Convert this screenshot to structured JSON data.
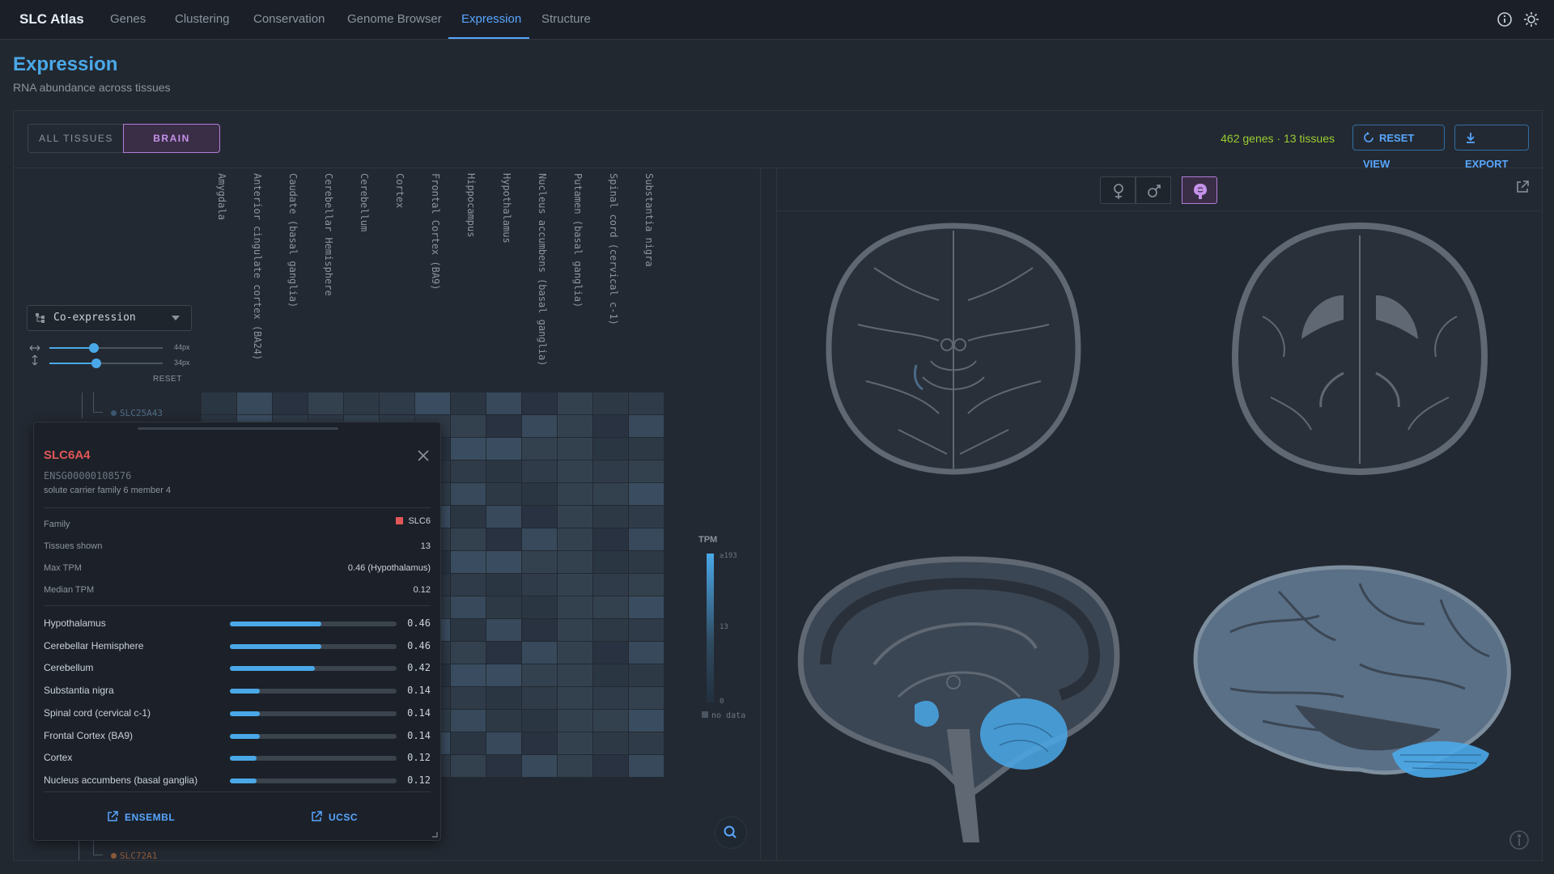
{
  "nav": {
    "brand": "SLC Atlas",
    "tabs": [
      "Genes",
      "Clustering",
      "Conservation",
      "Genome Browser",
      "Expression",
      "Structure"
    ],
    "active_tab": "Expression"
  },
  "header": {
    "title": "Expression",
    "subtitle": "RNA abundance across tissues"
  },
  "toolbar": {
    "segment_all": "ALL TISSUES",
    "segment_brain": "BRAIN",
    "active_segment": "BRAIN",
    "stats": "462 genes · 13 tissues",
    "reset_view": "RESET VIEW",
    "export": "EXPORT"
  },
  "heatmap": {
    "columns": [
      "Amygdala",
      "Anterior cingulate cortex (BA24)",
      "Caudate (basal ganglia)",
      "Cerebellar Hemisphere",
      "Cerebellum",
      "Cortex",
      "Frontal Cortex (BA9)",
      "Hippocampus",
      "Hypothalamus",
      "Nucleus accumbens (basal ganglia)",
      "Putamen (basal ganglia)",
      "Spinal cord (cervical c-1)",
      "Substantia nigra"
    ],
    "visible_genes": [
      "SLC25A43",
      "SLC72A1"
    ],
    "coexpression": {
      "label": "Co-expression",
      "width_value": "44px",
      "height_value": "34px",
      "reset": "RESET"
    },
    "legend": {
      "title": "TPM",
      "ticks": [
        "≥193",
        "13",
        "0"
      ],
      "no_data": "no data"
    }
  },
  "popup": {
    "gene": "SLC6A4",
    "ensembl_id": "ENSG00000108576",
    "description": "solute carrier family 6 member 4",
    "family_label": "Family",
    "family_value": "SLC6",
    "family_color": "#e05757",
    "tissues_label": "Tissues shown",
    "tissues_value": "13",
    "max_label": "Max TPM",
    "max_value": "0.46 (Hypothalamus)",
    "median_label": "Median TPM",
    "median_value": "0.12",
    "top_tissues": [
      {
        "name": "Hypothalamus",
        "value": "0.46",
        "fraction": 0.55
      },
      {
        "name": "Cerebellar Hemisphere",
        "value": "0.46",
        "fraction": 0.55
      },
      {
        "name": "Cerebellum",
        "value": "0.42",
        "fraction": 0.51
      },
      {
        "name": "Substantia nigra",
        "value": "0.14",
        "fraction": 0.18
      },
      {
        "name": "Spinal cord (cervical c-1)",
        "value": "0.14",
        "fraction": 0.18
      },
      {
        "name": "Frontal Cortex (BA9)",
        "value": "0.14",
        "fraction": 0.18
      },
      {
        "name": "Cortex",
        "value": "0.12",
        "fraction": 0.16
      },
      {
        "name": "Nucleus accumbens (basal ganglia)",
        "value": "0.12",
        "fraction": 0.16
      }
    ],
    "link_ensembl": "ENSEMBL",
    "link_ucsc": "UCSC"
  },
  "anatomy": {
    "views": [
      "female-icon",
      "male-icon",
      "brain-icon"
    ],
    "active_view": "brain-icon"
  },
  "colors": {
    "accent": "#4aa8e8",
    "brain_segment": "#b27cd6",
    "stats": "#9acd32",
    "gene_highlight": "#e05757"
  }
}
